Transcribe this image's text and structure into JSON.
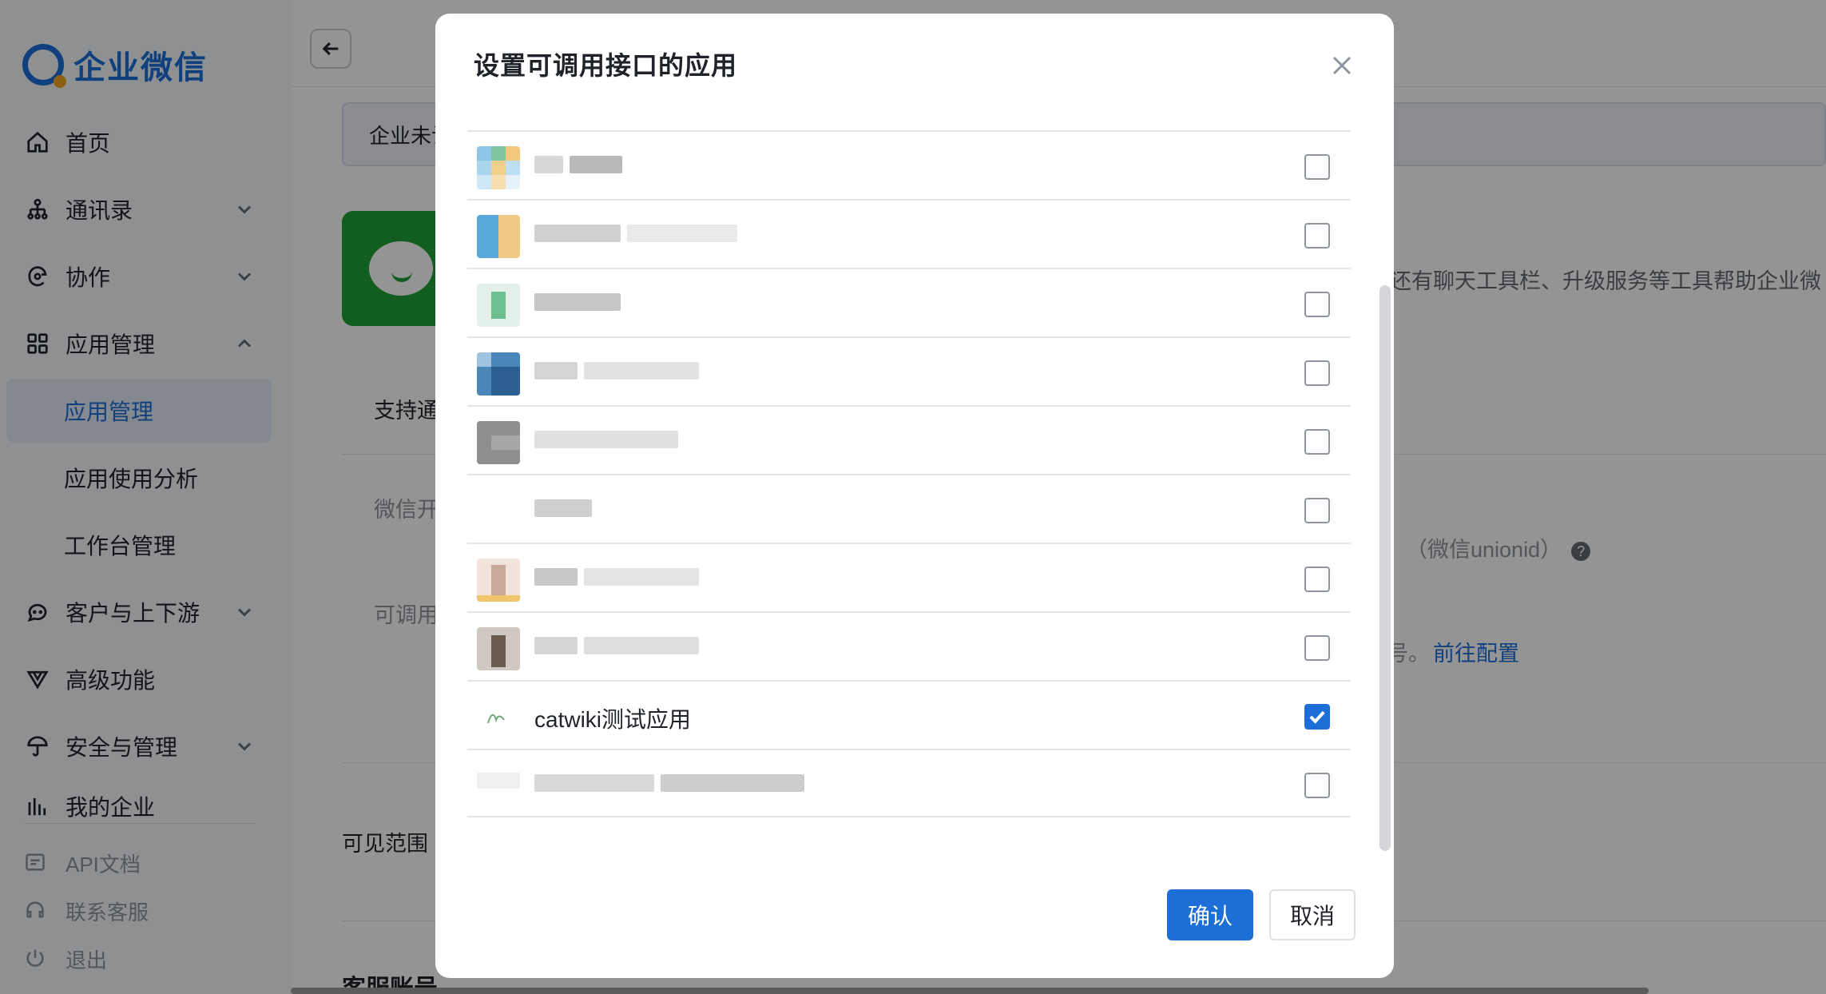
{
  "sidebar": {
    "logo_text": "企业微信",
    "items": [
      {
        "label": "首页",
        "icon": "home-icon"
      },
      {
        "label": "通讯录",
        "icon": "org-chart-icon"
      },
      {
        "label": "协作",
        "icon": "collab-icon"
      },
      {
        "label": "应用管理",
        "icon": "apps-grid-icon"
      },
      {
        "label": "客户与上下游",
        "icon": "chat-bubble-icon"
      },
      {
        "label": "高级功能",
        "icon": "advanced-icon"
      },
      {
        "label": "安全与管理",
        "icon": "umbrella-icon"
      },
      {
        "label": "我的企业",
        "icon": "building-icon"
      }
    ],
    "sub_items": [
      "应用管理",
      "应用使用分析",
      "工作台管理"
    ],
    "footer": [
      {
        "label": "API文档",
        "icon": "api-doc-icon"
      },
      {
        "label": "联系客服",
        "icon": "headset-icon"
      },
      {
        "label": "退出",
        "icon": "power-icon"
      }
    ]
  },
  "background": {
    "notice_text": "企业未认",
    "desc_tail": "还有聊天工具栏、升级服务等工具帮助企业微",
    "support_label": "支持通",
    "wechat_open": "微信开",
    "unionid_note": "（微信unionid）",
    "callable": "可调用",
    "hao": "号。",
    "go_config": "前往配置",
    "visible_range": "可见范围",
    "kefu_account": "客服账号"
  },
  "modal": {
    "title": "设置可调用接口的应用",
    "apps": [
      {
        "name": "",
        "checked": false
      },
      {
        "name": "",
        "checked": false
      },
      {
        "name": "",
        "checked": false
      },
      {
        "name": "",
        "checked": false
      },
      {
        "name": "",
        "checked": false
      },
      {
        "name": "",
        "checked": false
      },
      {
        "name": "",
        "checked": false
      },
      {
        "name": "",
        "checked": false
      },
      {
        "name": "catwiki测试应用",
        "checked": true
      },
      {
        "name": "",
        "checked": false
      }
    ],
    "confirm_label": "确认",
    "cancel_label": "取消"
  },
  "colors": {
    "accent": "#1d6fd8",
    "brand_green": "#1fa038"
  }
}
